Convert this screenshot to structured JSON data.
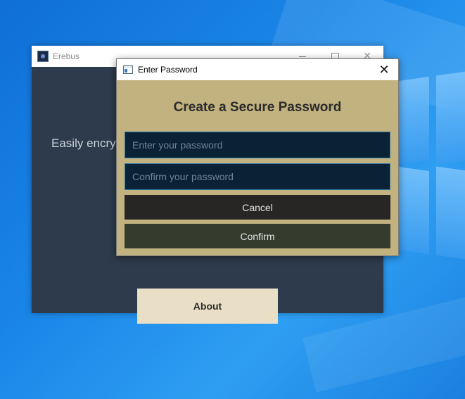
{
  "desktop": {
    "background_color": "#1a86e8"
  },
  "main_window": {
    "title": "Erebus",
    "tagline": "Easily encry",
    "about_label": "About",
    "colors": {
      "body": "#2e3b4c",
      "about_button": "#e8dfc6"
    }
  },
  "dialog": {
    "title": "Enter Password",
    "close_glyph": "✕",
    "heading": "Create a Secure Password",
    "password_placeholder": "Enter your password",
    "confirm_placeholder": "Confirm your password",
    "cancel_label": "Cancel",
    "confirm_label": "Confirm",
    "colors": {
      "background": "#c2b280",
      "field_background": "#0b2135",
      "field_border": "#2f7aa6",
      "cancel_button": "#282624",
      "confirm_button": "#353c2e"
    }
  },
  "icons": {
    "main_app_icon": "erebus-app-icon",
    "dialog_icon": "window-icon",
    "minimize": "minimize-icon",
    "maximize": "maximize-icon",
    "close": "close-icon"
  }
}
